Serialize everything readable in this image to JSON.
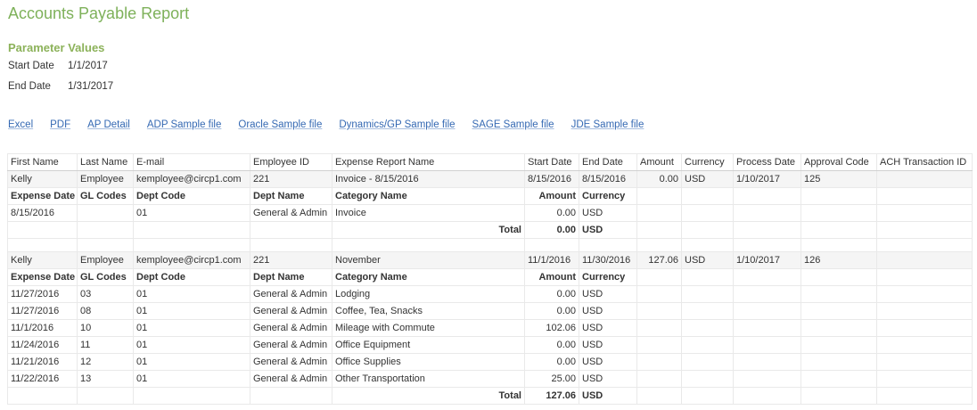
{
  "title": "Accounts Payable Report",
  "parameters": {
    "heading": "Parameter Values",
    "start_label": "Start Date",
    "start_value": "1/1/2017",
    "end_label": "End Date",
    "end_value": "1/31/2017"
  },
  "links": [
    "Excel",
    "PDF",
    "AP Detail",
    "ADP Sample file",
    "Oracle Sample file",
    "Dynamics/GP Sample file",
    "SAGE Sample file",
    "JDE Sample file"
  ],
  "columns": [
    "First Name",
    "Last Name",
    "E-mail",
    "Employee ID",
    "Expense Report Name",
    "Start Date",
    "End Date",
    "Amount",
    "Currency",
    "Process Date",
    "Approval Code",
    "ACH Transaction ID"
  ],
  "detail_columns": [
    "Expense Date",
    "GL Codes",
    "Dept Code",
    "Dept Name",
    "Category Name",
    "Amount",
    "Currency"
  ],
  "total_label": "Total",
  "reports": [
    {
      "first_name": "Kelly",
      "last_name": "Employee",
      "email": "kemployee@circp1.com",
      "employee_id": "221",
      "report_name": "Invoice - 8/15/2016",
      "start_date": "8/15/2016",
      "end_date": "8/15/2016",
      "amount": "0.00",
      "currency": "USD",
      "process_date": "1/10/2017",
      "approval_code": "125",
      "ach_id": "",
      "lines": [
        [
          "8/15/2016",
          "",
          "01",
          "General & Admin",
          "Invoice",
          "0.00",
          "USD"
        ]
      ],
      "total": "0.00",
      "total_currency": "USD"
    },
    {
      "first_name": "Kelly",
      "last_name": "Employee",
      "email": "kemployee@circp1.com",
      "employee_id": "221",
      "report_name": "November",
      "start_date": "11/1/2016",
      "end_date": "11/30/2016",
      "amount": "127.06",
      "currency": "USD",
      "process_date": "1/10/2017",
      "approval_code": "126",
      "ach_id": "",
      "lines": [
        [
          "11/27/2016",
          "03",
          "01",
          "General & Admin",
          "Lodging",
          "0.00",
          "USD"
        ],
        [
          "11/27/2016",
          "08",
          "01",
          "General & Admin",
          "Coffee, Tea, Snacks",
          "0.00",
          "USD"
        ],
        [
          "11/1/2016",
          "10",
          "01",
          "General & Admin",
          "Mileage with Commute",
          "102.06",
          "USD"
        ],
        [
          "11/24/2016",
          "11",
          "01",
          "General & Admin",
          "Office Equipment",
          "0.00",
          "USD"
        ],
        [
          "11/21/2016",
          "12",
          "01",
          "General & Admin",
          "Office Supplies",
          "0.00",
          "USD"
        ],
        [
          "11/22/2016",
          "13",
          "01",
          "General & Admin",
          "Other Transportation",
          "25.00",
          "USD"
        ]
      ],
      "total": "127.06",
      "total_currency": "USD"
    }
  ]
}
